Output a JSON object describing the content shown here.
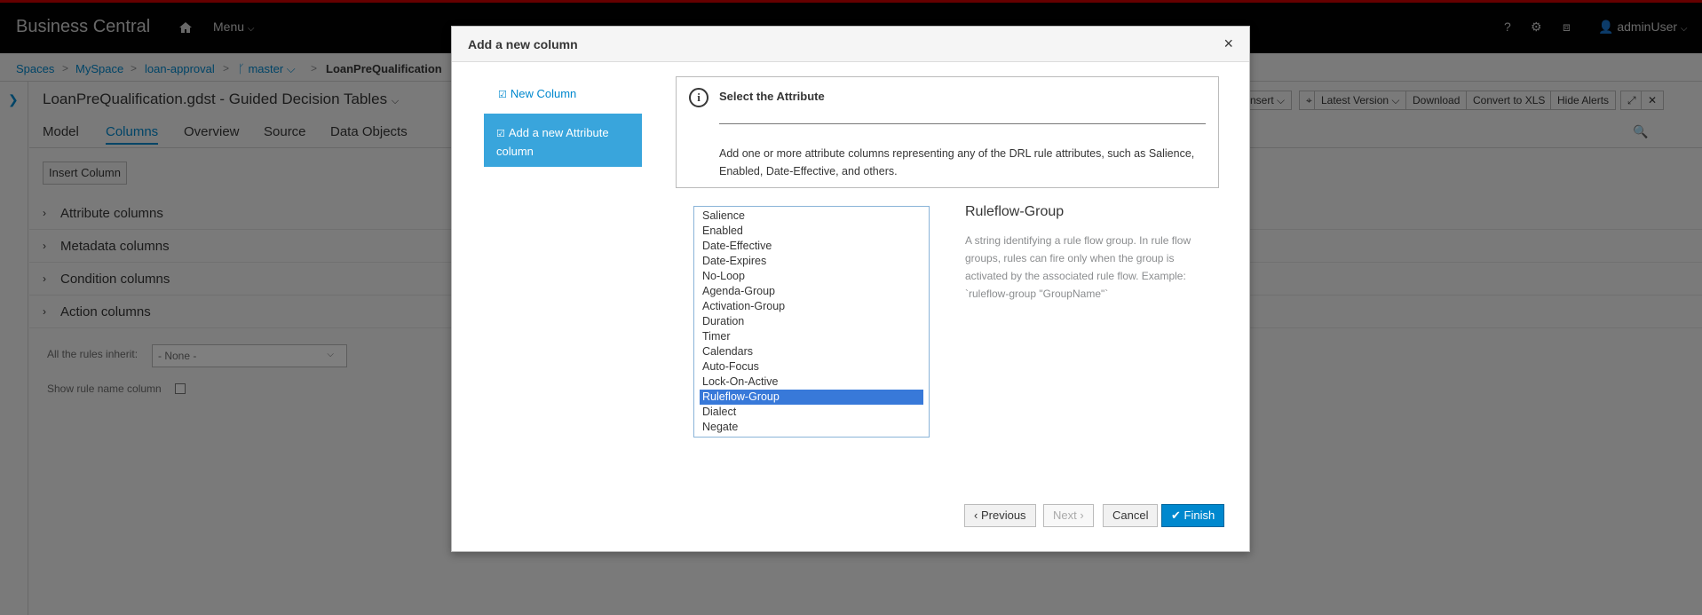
{
  "app": {
    "brand": "Business Central",
    "menu_label": "Menu",
    "help": "?",
    "user": "adminUser"
  },
  "breadcrumb": [
    "Spaces",
    "MySpace",
    "loan-approval",
    "master"
  ],
  "breadcrumb_current": "LoanPreQualification",
  "editor": {
    "title": "LoanPreQualification.gdst - Guided Decision Tables",
    "tabs": [
      "Model",
      "Columns",
      "Overview",
      "Source",
      "Data Objects"
    ],
    "active_tab": "Columns",
    "toolbar": [
      "nsert",
      "Latest Version",
      "Download",
      "Convert to XLS",
      "Hide Alerts"
    ],
    "insert_column": "Insert Column",
    "sections": [
      "Attribute columns",
      "Metadata columns",
      "Condition columns",
      "Action columns"
    ],
    "inherit_label": "All the rules inherit:",
    "inherit_value": "- None -",
    "show_rule_name": "Show rule name column"
  },
  "modal": {
    "title": "Add a new column",
    "close": "×",
    "steps": [
      "New Column",
      "Add a new Attribute column"
    ],
    "info_title": "Select the Attribute",
    "info_text": "Add one or more attribute columns representing any of the DRL rule attributes, such as Salience, Enabled, Date-Effective, and others.",
    "attributes": [
      "Salience",
      "Enabled",
      "Date-Effective",
      "Date-Expires",
      "No-Loop",
      "Agenda-Group",
      "Activation-Group",
      "Duration",
      "Timer",
      "Calendars",
      "Auto-Focus",
      "Lock-On-Active",
      "Ruleflow-Group",
      "Dialect",
      "Negate"
    ],
    "selected": "Ruleflow-Group",
    "desc_title": "Ruleflow-Group",
    "desc_text": "A string identifying a rule flow group. In rule flow groups, rules can fire only when the group is activated by the associated rule flow. Example: `ruleflow-group \"GroupName\"`",
    "buttons": {
      "previous": "Previous",
      "next": "Next",
      "cancel": "Cancel",
      "finish": "Finish"
    }
  },
  "colors": {
    "accent": "#0088ce",
    "selected_step": "#39a5dc",
    "selected_option": "#3879d9"
  }
}
